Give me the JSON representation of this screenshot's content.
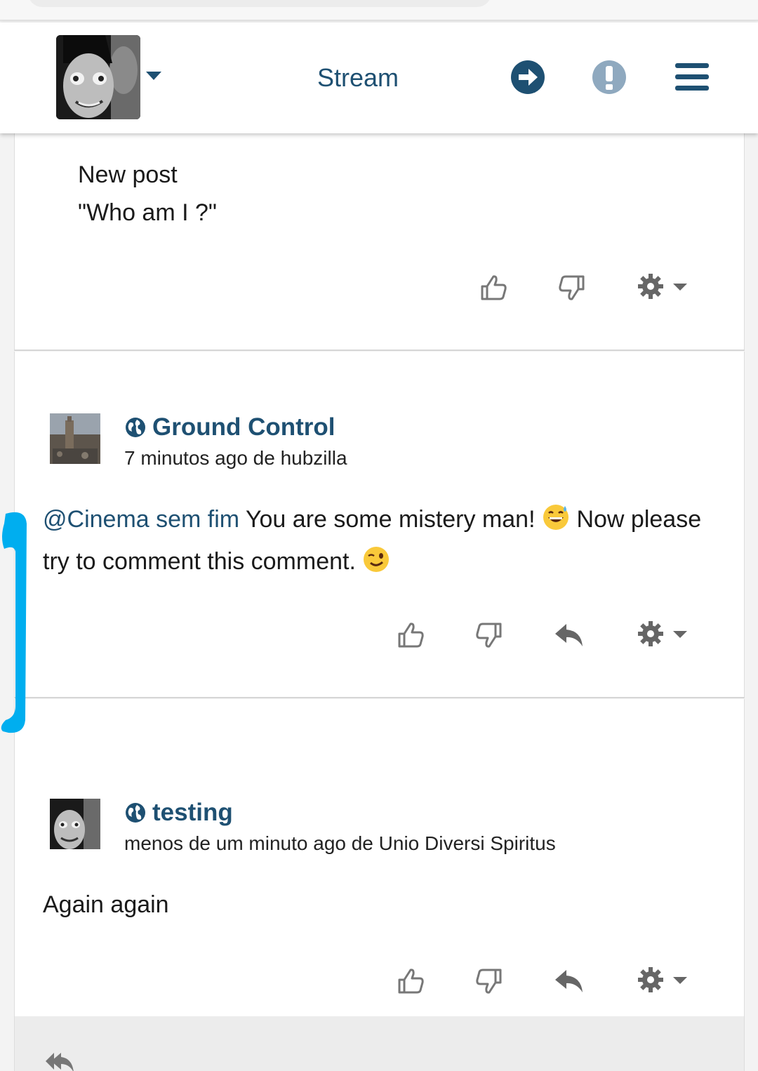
{
  "header": {
    "title": "Stream",
    "icons": [
      "user-avatar",
      "chevron-down-icon",
      "arrow-right-circle-icon",
      "exclamation-circle-icon",
      "menu-icon"
    ]
  },
  "posts": [
    {
      "lines": [
        "New post",
        "\"Who am I ?\""
      ],
      "actions": [
        "thumbs-up-icon",
        "thumbs-down-icon",
        "gear-icon"
      ]
    },
    {
      "author": "Ground Control",
      "meta": "7 minutos ago de hubzilla",
      "mention": "@Cinema sem fim",
      "text_1": " You are some mistery man! ",
      "text_2": " Now please try to comment this comment. ",
      "emojis": [
        "grinning-sweat-emoji",
        "winking-emoji"
      ],
      "actions": [
        "thumbs-up-icon",
        "thumbs-down-icon",
        "reply-icon",
        "gear-icon"
      ]
    },
    {
      "author": "testing",
      "meta": "menos de um minuto ago de Unio Diversi Spiritus",
      "body": "Again again",
      "actions": [
        "thumbs-up-icon",
        "thumbs-down-icon",
        "reply-icon",
        "gear-icon"
      ]
    }
  ],
  "footer": {
    "icon": "reply-all-icon"
  },
  "colors": {
    "accent": "#1e5072",
    "annotation": "#00aeef"
  }
}
